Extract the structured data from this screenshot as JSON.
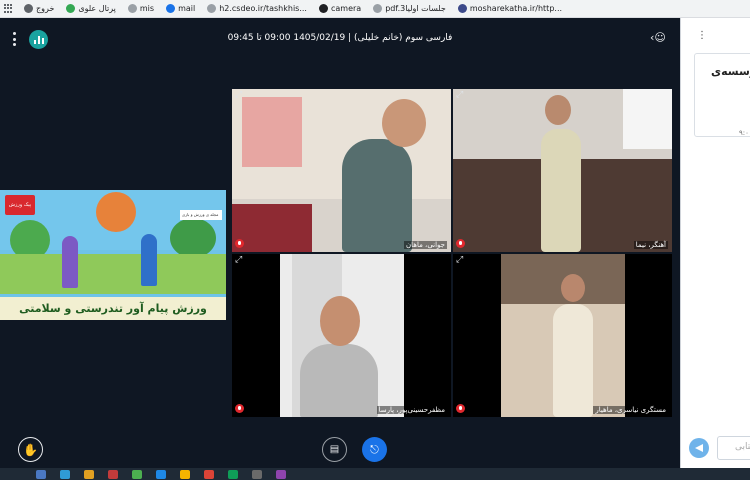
{
  "bookmarks": [
    {
      "label": "خروج",
      "color": "#5f6368"
    },
    {
      "label": "پرتال علوی",
      "color": "#34a853"
    },
    {
      "label": "mis",
      "color": "#5f6368"
    },
    {
      "label": "mail",
      "color": "#1a73e8"
    },
    {
      "label": "h2.csdeo.ir/tashkhis...",
      "color": "#5f6368"
    },
    {
      "label": "camera",
      "color": "#202124"
    },
    {
      "label": "pdf.3جلسات اولیا",
      "color": "#5f6368"
    },
    {
      "label": "mosharekatha.ir/http...",
      "color": "#3c4a8a"
    }
  ],
  "header": {
    "title": "فارسی سوم (خانم خلیلی) | 1405/02/19 09:00 تا 09:45"
  },
  "shared_video": {
    "caption": "ورزش پیام آور تندرستی و سلامتی",
    "badge": "پیک ورزش",
    "side_note": "مجله ی ورزش و بازی"
  },
  "participants": [
    {
      "name": "جوانی، ماهان"
    },
    {
      "name": "آهنگر، نیما"
    },
    {
      "name": "مظفرحسینی‌پور، پارسا"
    },
    {
      "name": "مستگری نیاسری، ماهیار"
    }
  ],
  "side_panel": {
    "card_text": "مؤسسه‌ی",
    "small_text": "۹:۰",
    "input_placeholder": "کتابی"
  },
  "colors": {
    "background": "#0f1723",
    "accent": "#1aa3a0",
    "mic_off": "#e0282e",
    "headset": "#1a73e8"
  }
}
